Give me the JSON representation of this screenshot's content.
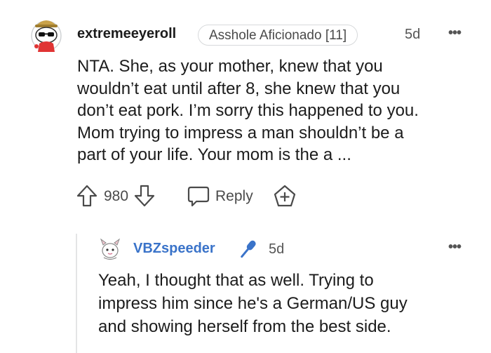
{
  "comment": {
    "username": "extremeeyeroll",
    "flair": "Asshole Aficionado [11]",
    "age": "5d",
    "more_icon": "more-horizontal-icon",
    "body_lines": [
      "NTA. She, as your mother, knew that you",
      "wouldn’t eat until after 8, she knew that you",
      "don’t eat pork. I’m sorry this happened to you.",
      "Mom trying to impress a man shouldn’t be a",
      "part of your life. Your mom is the a ..."
    ],
    "score": "980",
    "reply_label": "Reply",
    "icons": {
      "upvote": "arrow-up-icon",
      "downvote": "arrow-down-icon",
      "reply": "speech-bubble-icon",
      "award": "award-plus-icon"
    }
  },
  "reply": {
    "username": "VBZspeeder",
    "username_color": "#3a73c9",
    "badge_icon": "microphone-icon",
    "age": "5d",
    "more_icon": "more-horizontal-icon",
    "body_lines": [
      "Yeah, I thought that as well. Trying to",
      "impress him since he's a German/US guy",
      "and showing herself from the best side."
    ]
  }
}
